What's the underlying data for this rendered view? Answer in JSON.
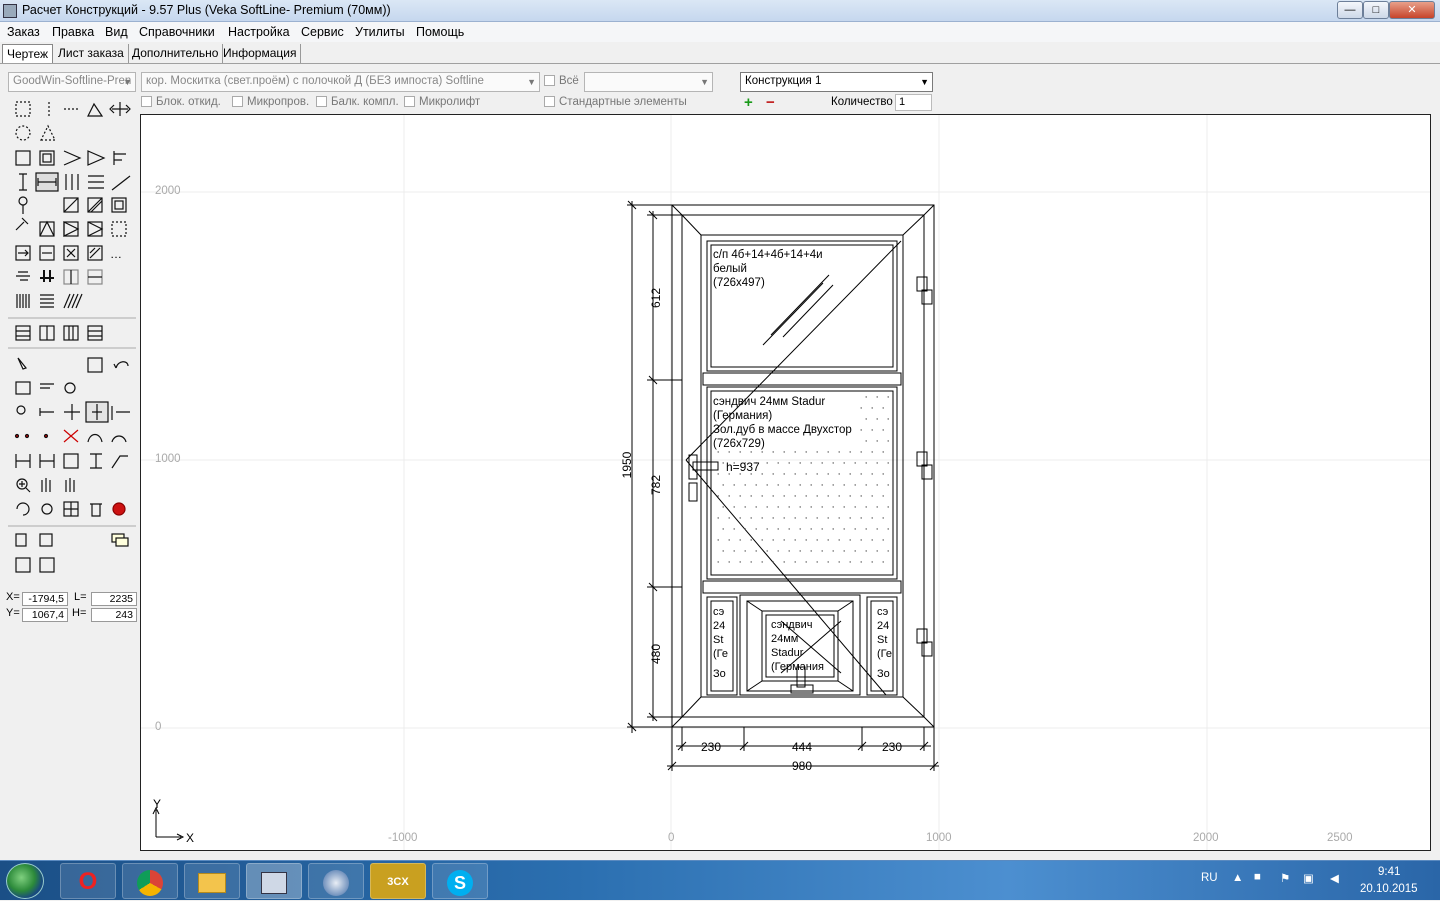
{
  "window": {
    "title": "Расчет Конструкций - 9.57 Plus (Veka SoftLine- Premium (70мм))",
    "buttons": {
      "minimize": "—",
      "maximize": "□",
      "close": "✕"
    }
  },
  "menu": [
    "Заказ",
    "Правка",
    "Вид",
    "Справочники",
    "Настройка",
    "Сервис",
    "Утилиты",
    "Помощь"
  ],
  "tabs": [
    "Чертеж",
    "Лист заказа",
    "Дополнительно",
    "Информация"
  ],
  "selectors": {
    "profile": "GoodWin-Softline-Pren",
    "component": "кор. Москитка (свет.проём) с полочкой Д (БЕЗ импоста) Softline",
    "all_label": "Всё",
    "construction": "Конструкция 1",
    "quantity_label": "Количество",
    "quantity_value": "1"
  },
  "checkboxes": [
    "Блок. откид.",
    "Микропров.",
    "Балк. компл.",
    "Микролифт"
  ],
  "standard_elements": "Стандартные элементы",
  "coords": {
    "x_label": "X=",
    "x": "-1794,5",
    "l_label": "L=",
    "l": "2235",
    "y_label": "Y=",
    "y": "1067,4",
    "h_label": "H=",
    "h": "243"
  },
  "drawing": {
    "y_ticks": [
      "2000",
      "1000",
      "0"
    ],
    "x_ticks": [
      "-1000",
      "0",
      "1000",
      "2000",
      "2500"
    ],
    "axis_x": "X",
    "axis_y": "Y",
    "dim_total_height": "1950",
    "dim_top": "612",
    "dim_middle": "782",
    "dim_bottom": "480",
    "dim_left": "230",
    "dim_center": "444",
    "dim_right": "230",
    "dim_total_width": "980",
    "handle_label": "h=937",
    "top_panel": [
      "с/п 4б+14+4б+14+4и",
      "белый",
      "(726x497)"
    ],
    "middle_panel": [
      "сэндвич 24мм Stadur",
      "(Германия)",
      "Зол.дуб в массе Двухстор",
      "(726x729)"
    ],
    "bottom_center": [
      "сэндвич",
      "24мм",
      "Stadur",
      "(Германия"
    ],
    "bottom_left": [
      "сэ",
      "24",
      "St",
      "(Ге",
      "Зо"
    ],
    "bottom_right": [
      "сэ",
      "24",
      "St",
      "(Ге",
      "Зо"
    ]
  },
  "taskbar": {
    "lang": "RU",
    "time": "9:41",
    "date": "20.10.2015"
  }
}
